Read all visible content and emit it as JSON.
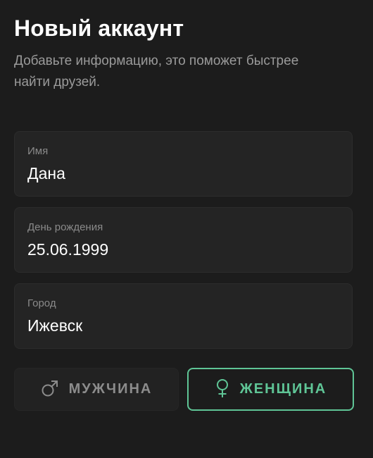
{
  "header": {
    "title": "Новый аккаунт",
    "subtitle": "Добавьте информацию, это поможет быстрее найти друзей."
  },
  "form": {
    "name": {
      "label": "Имя",
      "value": "Дана"
    },
    "birthday": {
      "label": "День рождения",
      "value": "25.06.1999"
    },
    "city": {
      "label": "Город",
      "value": "Ижевск"
    }
  },
  "gender": {
    "male_label": "МУЖЧИНА",
    "female_label": "ЖЕНЩИНА",
    "selected": "female"
  },
  "colors": {
    "background": "#1c1c1c",
    "field_background": "#242424",
    "accent": "#5fc596",
    "muted_text": "#9a9a9a"
  },
  "icons": {
    "male": "male-sign-icon",
    "female": "female-sign-icon"
  }
}
